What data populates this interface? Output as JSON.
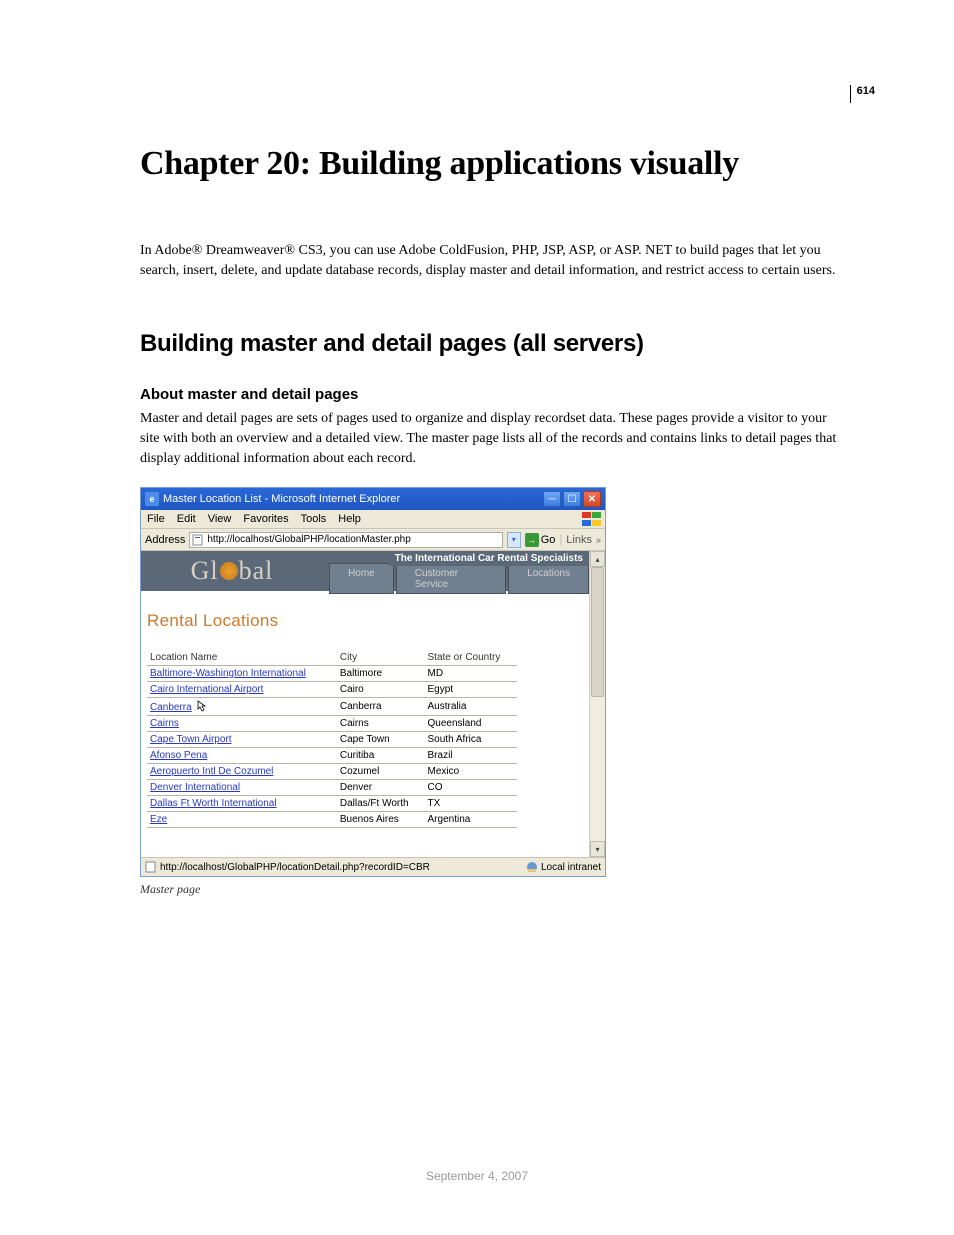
{
  "page_number": "614",
  "chapter_title": "Chapter 20: Building applications visually",
  "intro": "In Adobe® Dreamweaver® CS3, you can use Adobe ColdFusion, PHP, JSP, ASP, or ASP. NET to build pages that let you search, insert, delete, and update database records, display master and detail information, and restrict access to certain users.",
  "section_title": "Building master and detail pages (all servers)",
  "subsection_title": "About master and detail pages",
  "body_1": "Master and detail pages are sets of pages used to organize and display recordset data. These pages provide a visitor to your site with both an overview and a detailed view. The master page lists all of the records and contains links to detail pages that display additional information about each record.",
  "browser": {
    "title": "Master Location List - Microsoft Internet Explorer",
    "menu": {
      "file": "File",
      "edit": "Edit",
      "view": "View",
      "favorites": "Favorites",
      "tools": "Tools",
      "help": "Help"
    },
    "address_label": "Address",
    "address_url": "http://localhost/GlobalPHP/locationMaster.php",
    "go_label": "Go",
    "links_label": "Links",
    "tagline": "The International Car Rental Specialists",
    "logo_left": "Gl",
    "logo_right": "bal",
    "nav": {
      "home": "Home",
      "cs": "Customer Service",
      "loc": "Locations"
    },
    "page_heading": "Rental Locations",
    "columns": {
      "c0": "Location Name",
      "c1": "City",
      "c2": "State or Country"
    },
    "rows": [
      {
        "name": "Baltimore-Washington International",
        "city": "Baltimore",
        "region": "MD"
      },
      {
        "name": "Cairo International Airport",
        "city": "Cairo",
        "region": "Egypt"
      },
      {
        "name": "Canberra",
        "city": "Canberra",
        "region": "Australia"
      },
      {
        "name": "Cairns",
        "city": "Cairns",
        "region": "Queensland"
      },
      {
        "name": "Cape Town Airport",
        "city": "Cape Town",
        "region": "South Africa"
      },
      {
        "name": "Afonso Pena",
        "city": "Curitiba",
        "region": "Brazil"
      },
      {
        "name": "Aeropuerto Intl De Cozumel",
        "city": "Cozumel",
        "region": "Mexico"
      },
      {
        "name": "Denver International",
        "city": "Denver",
        "region": "CO"
      },
      {
        "name": "Dallas Ft Worth International",
        "city": "Dallas/Ft Worth",
        "region": "TX"
      },
      {
        "name": "Eze",
        "city": "Buenos Aires",
        "region": "Argentina"
      }
    ],
    "status_url": "http://localhost/GlobalPHP/locationDetail.php?recordID=CBR",
    "status_zone": "Local intranet"
  },
  "caption": "Master page",
  "footer_date": "September 4, 2007"
}
